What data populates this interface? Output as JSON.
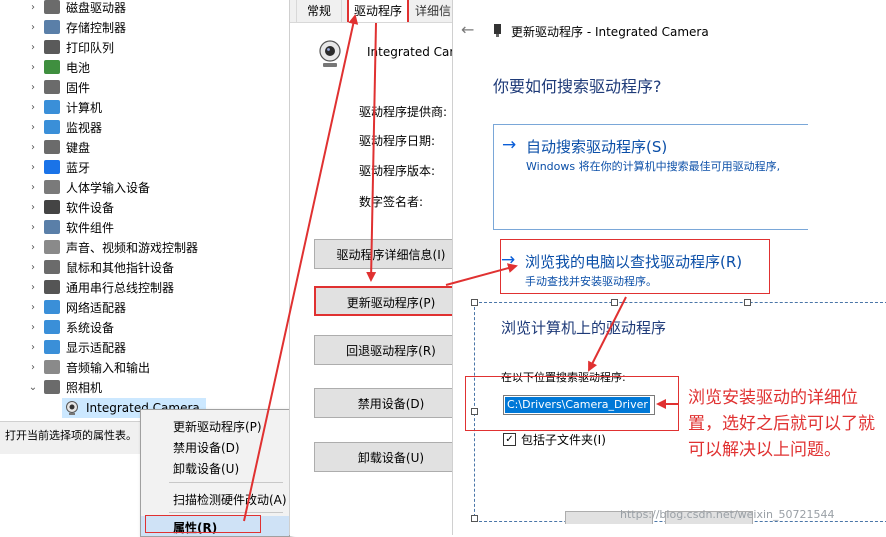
{
  "device_tree": {
    "items": [
      {
        "label": "磁盘驱动器",
        "icon": "disk-drive-icon",
        "color": "#6b6b6b"
      },
      {
        "label": "存储控制器",
        "icon": "storage-controller-icon",
        "color": "#5a7fa8"
      },
      {
        "label": "打印队列",
        "icon": "printer-icon",
        "color": "#5a5a5a"
      },
      {
        "label": "电池",
        "icon": "battery-icon",
        "color": "#3f8f3f"
      },
      {
        "label": "固件",
        "icon": "firmware-icon",
        "color": "#6b6b6b"
      },
      {
        "label": "计算机",
        "icon": "computer-icon",
        "color": "#3a8fd8"
      },
      {
        "label": "监视器",
        "icon": "monitor-icon",
        "color": "#3a8fd8"
      },
      {
        "label": "键盘",
        "icon": "keyboard-icon",
        "color": "#6b6b6b"
      },
      {
        "label": "蓝牙",
        "icon": "bluetooth-icon",
        "color": "#1a73e8"
      },
      {
        "label": "人体学输入设备",
        "icon": "hid-icon",
        "color": "#7a7a7a"
      },
      {
        "label": "软件设备",
        "icon": "software-device-icon",
        "color": "#444444"
      },
      {
        "label": "软件组件",
        "icon": "software-component-icon",
        "color": "#5a7fa8"
      },
      {
        "label": "声音、视频和游戏控制器",
        "icon": "speaker-icon",
        "color": "#8a8a8a"
      },
      {
        "label": "鼠标和其他指针设备",
        "icon": "mouse-icon",
        "color": "#6b6b6b"
      },
      {
        "label": "通用串行总线控制器",
        "icon": "usb-icon",
        "color": "#555555"
      },
      {
        "label": "网络适配器",
        "icon": "network-adapter-icon",
        "color": "#3a8fd8"
      },
      {
        "label": "系统设备",
        "icon": "system-device-icon",
        "color": "#3a8fd8"
      },
      {
        "label": "显示适配器",
        "icon": "display-adapter-icon",
        "color": "#3a8fd8"
      },
      {
        "label": "音频输入和输出",
        "icon": "audio-io-icon",
        "color": "#8a8a8a"
      },
      {
        "label": "照相机",
        "icon": "camera-icon",
        "color": "#6b6b6b"
      }
    ],
    "selected_child": "Integrated Camera",
    "status_text": "打开当前选择项的属性表。"
  },
  "context_menu": {
    "items": [
      "更新驱动程序(P)",
      "禁用设备(D)",
      "卸载设备(U)",
      "扫描检测硬件改动(A)",
      "属性(R)"
    ]
  },
  "properties": {
    "tabs": [
      "常规",
      "驱动程序",
      "详细信"
    ],
    "device_name": "Integrated Came",
    "fields": [
      "驱动程序提供商:",
      "驱动程序日期:",
      "驱动程序版本:",
      "数字签名者:"
    ],
    "buttons": [
      "驱动程序详细信息(I)",
      "更新驱动程序(P)",
      "回退驱动程序(R)",
      "禁用设备(D)",
      "卸载设备(U)"
    ]
  },
  "update_window": {
    "title": "更新驱动程序 - Integrated Camera",
    "question": "你要如何搜索驱动程序?",
    "option_auto": {
      "title": "自动搜索驱动程序(S)",
      "desc": "Windows 将在你的计算机中搜索最佳可用驱动程序,"
    },
    "option_browse": {
      "title": "浏览我的电脑以查找驱动程序(R)",
      "desc": "手动查找并安装驱动程序。"
    }
  },
  "browse_dialog": {
    "title": "浏览计算机上的驱动程序",
    "path_label": "在以下位置搜索驱动程序:",
    "path_value": "C:\\Drivers\\Camera_Driver",
    "include_subfolders": "包括子文件夹(I)",
    "include_subfolders_checked": true
  },
  "annotation": {
    "text": "浏览安装驱动的详细位置，选好之后就可以了就可以解决以上问题。"
  },
  "watermark": "https://blog.csdn.net/weixin_50721544",
  "colors": {
    "annotation_red": "#e03131",
    "link_blue": "#0b4fa8",
    "selection_blue": "#0078d7"
  }
}
